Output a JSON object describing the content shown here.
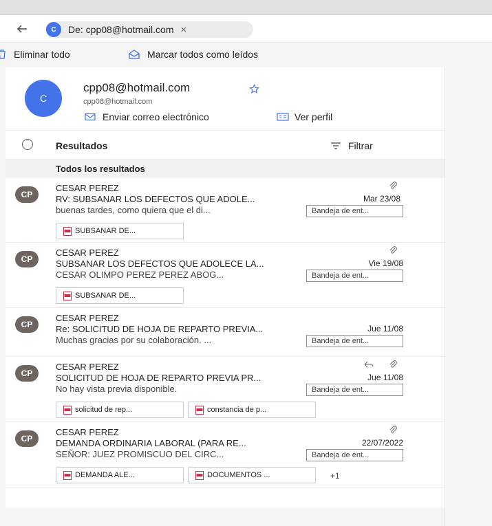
{
  "search": {
    "chip_initial": "C",
    "chip_label": "De: cpp08@hotmail.com",
    "close_glyph": "×"
  },
  "commands": {
    "delete_all": "Eliminar todo",
    "mark_all_read": "Marcar todos como leídos"
  },
  "persona": {
    "initial": "C",
    "name": "cpp08@hotmail.com",
    "email": "cpp08@hotmail.com",
    "send_email": "Enviar correo electrónico",
    "view_profile": "Ver perfil"
  },
  "results": {
    "title": "Resultados",
    "filter": "Filtrar",
    "section": "Todos los resultados"
  },
  "messages": [
    {
      "initials": "CP",
      "sender": "CESAR PEREZ",
      "subject": "RV: SUBSANAR LOS DEFECTOS QUE ADOLE...",
      "preview": "buenas tardes, como quiera que el di...",
      "date": "Mar 23/08",
      "folder": "Bandeja de ent...",
      "attachments": [
        "SUBSANAR DE..."
      ]
    },
    {
      "initials": "CP",
      "sender": "CESAR PEREZ",
      "subject": "SUBSANAR LOS DEFECTOS QUE ADOLECE LA...",
      "preview": "CESAR OLIMPO PEREZ PEREZ ABOG...",
      "date": "Vie 19/08",
      "folder": "Bandeja de ent...",
      "attachments": [
        "SUBSANAR DE..."
      ]
    },
    {
      "initials": "CP",
      "sender": "CESAR PEREZ",
      "subject": "Re: SOLICITUD DE HOJA DE REPARTO PREVIA...",
      "preview": "Muchas gracias por su colaboración. ...",
      "date": "Jue 11/08",
      "folder": "Bandeja de ent..."
    },
    {
      "initials": "CP",
      "sender": "CESAR PEREZ",
      "subject": "SOLICITUD DE HOJA DE REPARTO PREVIA PR...",
      "preview": "No hay vista previa disponible.",
      "date": "Jue 11/08",
      "folder": "Bandeja de ent...",
      "attachments": [
        "solicitud de rep...",
        "constancia de p..."
      ]
    },
    {
      "initials": "CP",
      "sender": "CESAR PEREZ",
      "subject": "DEMANDA ORDINARIA LABORAL (PARA RE...",
      "preview": "SEÑOR: JUEZ PROMISCUO DEL CIRC...",
      "date": "22/07/2022",
      "folder": "Bandeja de ent...",
      "attachments": [
        "DEMANDA ALE...",
        "DOCUMENTOS ..."
      ],
      "more": "+1"
    }
  ],
  "icons": {
    "back": "arrow-left-icon",
    "trash": "trash-icon",
    "envelope_open": "envelope-open-icon",
    "star": "star-icon",
    "mail": "mail-icon",
    "contact_card": "contact-card-icon",
    "check": "check-circle-icon",
    "filter": "filter-icon",
    "paperclip": "paperclip-icon",
    "reply": "reply-icon",
    "pdf": "pdf-file-icon"
  },
  "colors": {
    "accent": "#4472e8",
    "avatar_gray": "#6e6560",
    "pdf_red": "#c4314b"
  }
}
